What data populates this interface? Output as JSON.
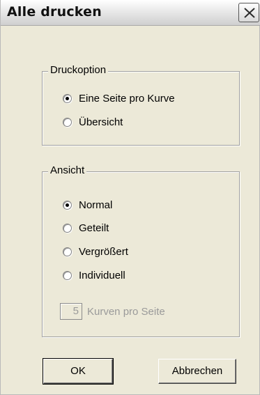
{
  "window": {
    "title": "Alle drucken",
    "close_icon": "close-icon"
  },
  "print_option_group": {
    "legend": "Druckoption",
    "options": [
      {
        "label": "Eine Seite pro Kurve",
        "checked": true
      },
      {
        "label": "Übersicht",
        "checked": false
      }
    ]
  },
  "view_group": {
    "legend": "Ansicht",
    "options": [
      {
        "label": "Normal",
        "checked": true
      },
      {
        "label": "Geteilt",
        "checked": false
      },
      {
        "label": "Vergrößert",
        "checked": false
      },
      {
        "label": "Individuell",
        "checked": false
      }
    ],
    "curves_per_page_value": "5",
    "curves_per_page_label": "Kurven pro Seite",
    "curves_per_page_enabled": false
  },
  "buttons": {
    "ok_label": "OK",
    "cancel_label": "Abbrechen"
  }
}
